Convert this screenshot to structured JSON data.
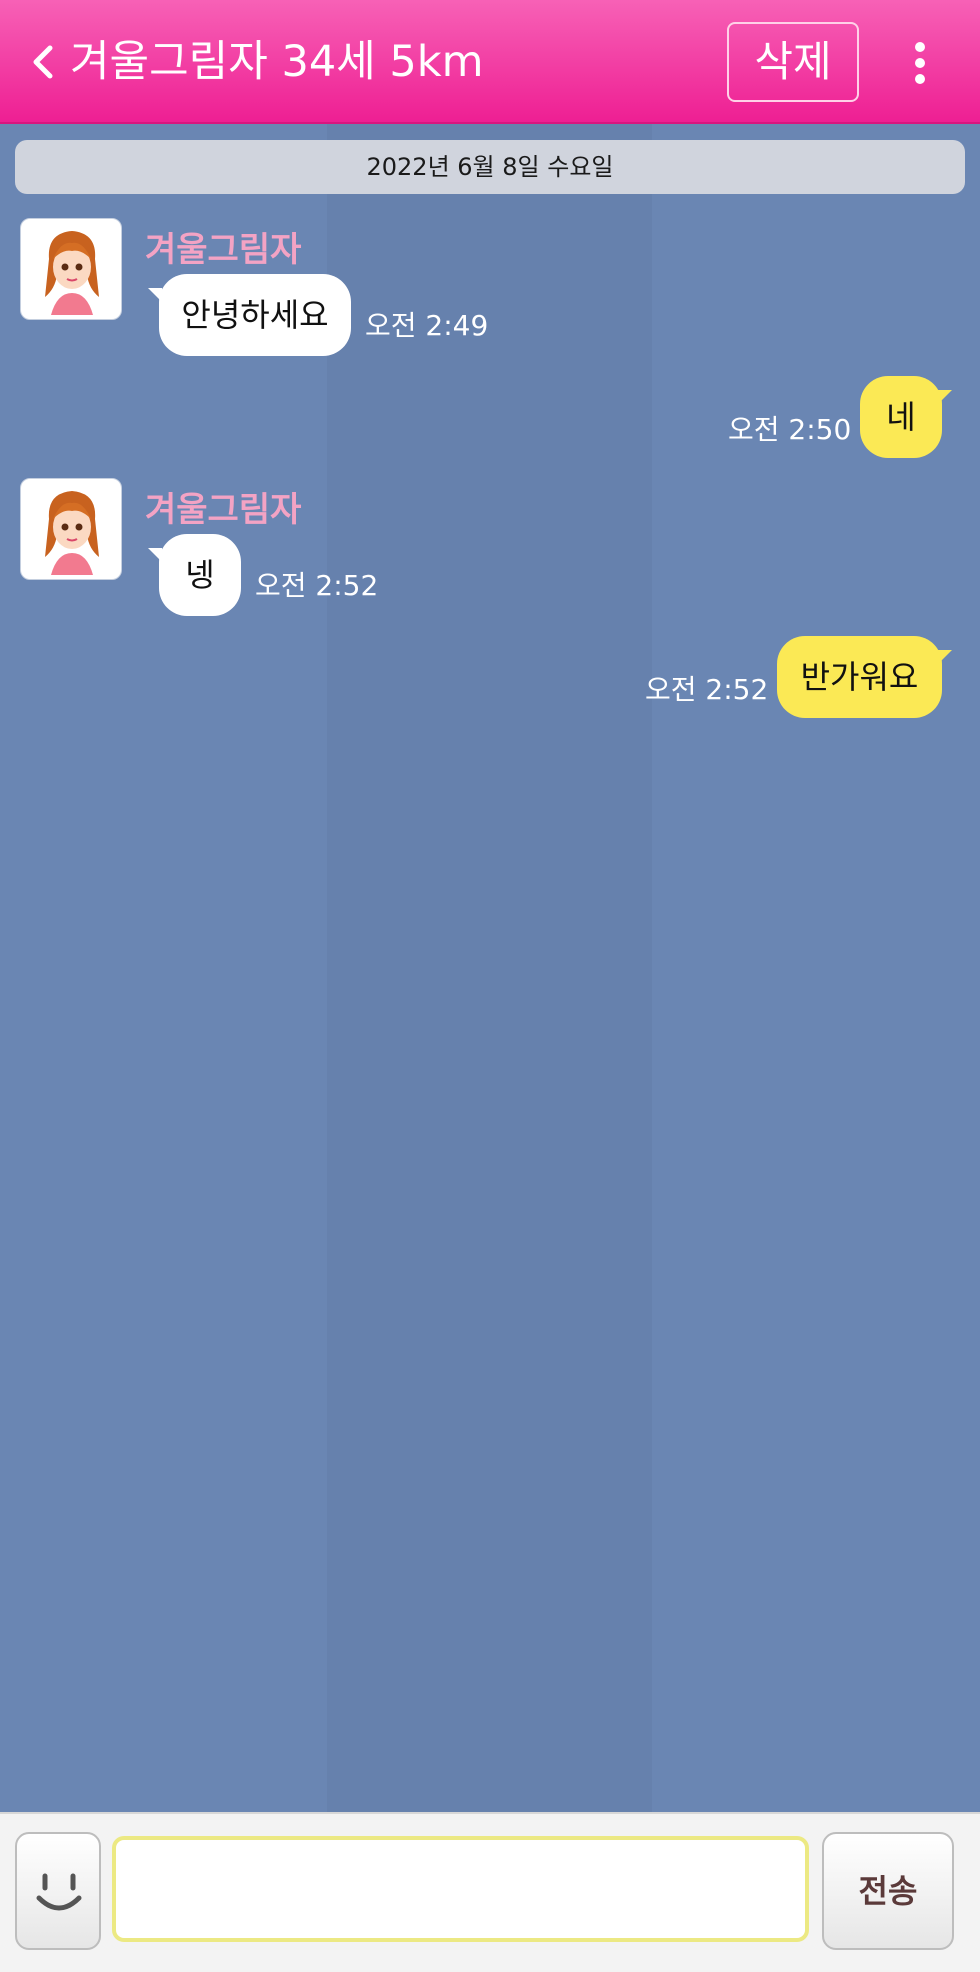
{
  "header": {
    "title": "겨울그림자 34세 5km",
    "delete_label": "삭제",
    "back_icon": "chevron-left-icon",
    "more_icon": "more-vertical-icon"
  },
  "chat": {
    "date": "2022년 6월 8일 수요일",
    "messages": [
      {
        "from": "them",
        "sender": "겨울그림자",
        "text": "안녕하세요",
        "time": "오전 2:49"
      },
      {
        "from": "me",
        "text": "네",
        "time": "오전 2:50"
      },
      {
        "from": "them",
        "sender": "겨울그림자",
        "text": "넹",
        "time": "오전 2:52"
      },
      {
        "from": "me",
        "text": "반가워요",
        "time": "오전 2:52"
      }
    ]
  },
  "input": {
    "placeholder": "",
    "value": "",
    "send_label": "전송",
    "emoji_icon": "smiley-icon"
  },
  "colors": {
    "header": "#ee1f93",
    "background": "#6a86b3",
    "incoming_bubble": "#ffffff",
    "outgoing_bubble": "#fbe955",
    "sender_name": "#f3a3c4"
  }
}
